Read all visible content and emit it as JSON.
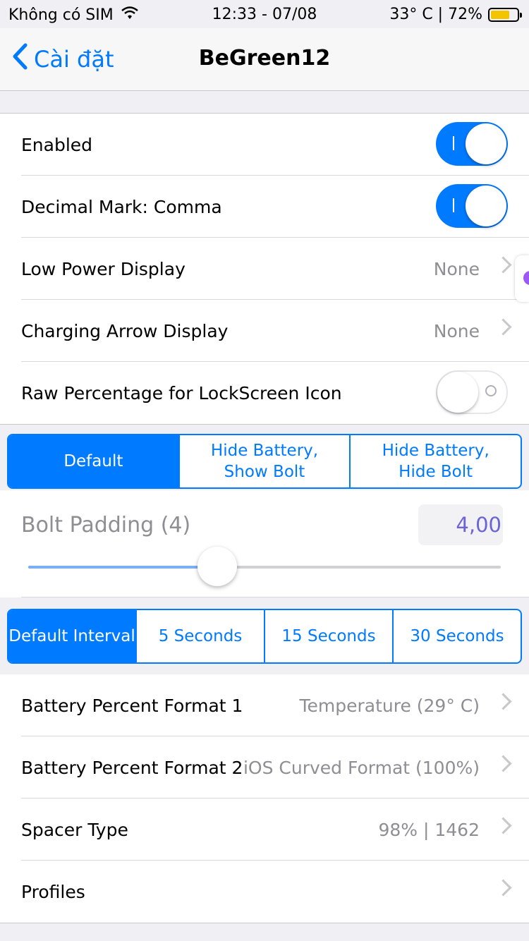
{
  "status": {
    "carrier": "Không có SIM",
    "time": "12:33 - 07/08",
    "right_text": "33° C | 72%",
    "battery_level": 0.72
  },
  "nav": {
    "back_label": "Cài đặt",
    "title": "BeGreen12"
  },
  "group1": {
    "enabled": {
      "label": "Enabled",
      "on": true
    },
    "decimal": {
      "label": "Decimal Mark: Comma",
      "on": true
    },
    "low_power": {
      "label": "Low Power Display",
      "value": "None"
    },
    "charging_arrow": {
      "label": "Charging Arrow Display",
      "value": "None"
    },
    "raw_percentage": {
      "label": "Raw Percentage for LockScreen Icon",
      "on": false
    }
  },
  "segment1": {
    "options": [
      "Default",
      "Hide Battery,\nShow Bolt",
      "Hide Battery,\nHide Bolt"
    ],
    "selected": 0
  },
  "slider": {
    "label": "Bolt Padding (4)",
    "value_text": "4,00",
    "fraction": 0.4
  },
  "segment2": {
    "options": [
      "Default Interval",
      "5 Seconds",
      "15 Seconds",
      "30 Seconds"
    ],
    "selected": 0
  },
  "group2": {
    "format1": {
      "label": "Battery Percent Format 1",
      "value": "Temperature (29° C)"
    },
    "format2": {
      "label": "Battery Percent Format 2",
      "value": "iOS Curved Format (100%)"
    },
    "spacer": {
      "label": "Spacer Type",
      "value": "98% | 1462"
    },
    "profiles": {
      "label": "Profiles",
      "value": ""
    }
  },
  "colors": {
    "accent": "#007aff",
    "battery": "#f5c400",
    "slider_fill": "#7aaef5"
  }
}
